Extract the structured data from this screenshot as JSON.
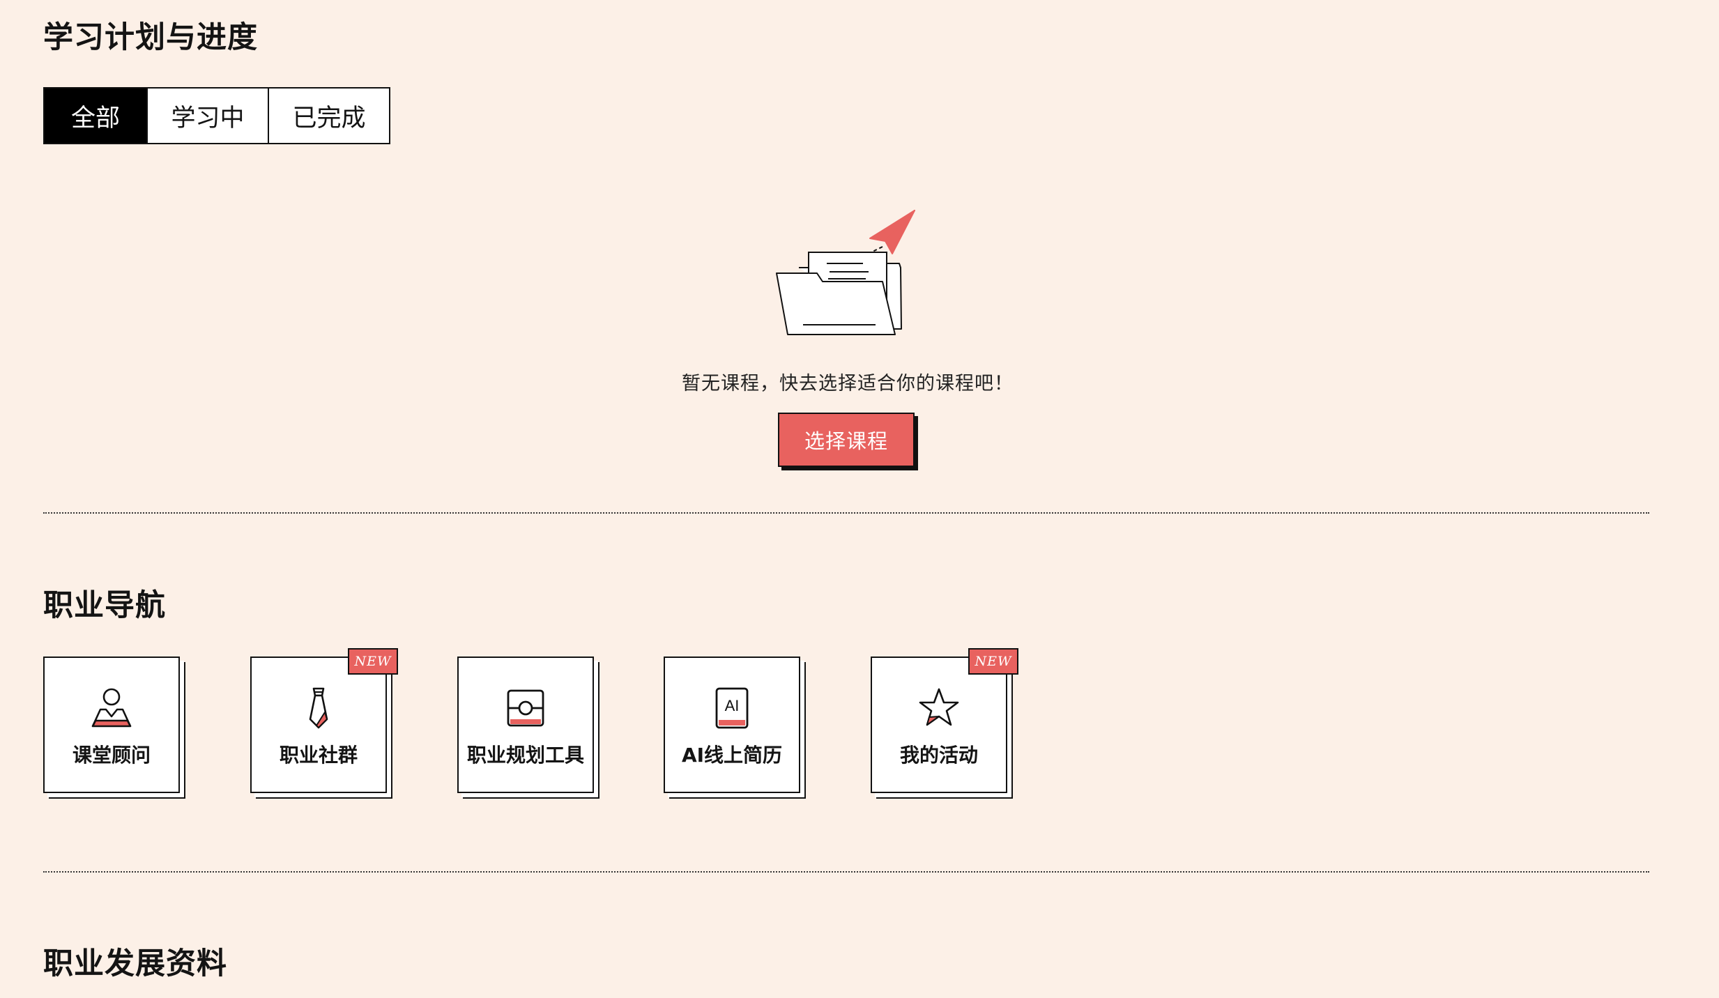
{
  "plan_section": {
    "title": "学习计划与进度",
    "tabs": [
      {
        "label": "全部",
        "active": true
      },
      {
        "label": "学习中",
        "active": false
      },
      {
        "label": "已完成",
        "active": false
      }
    ],
    "empty_state": {
      "illustration_icon": "folder-paper-plane-icon",
      "message": "暂无课程，快去选择适合你的课程吧！",
      "button_label": "选择课程"
    }
  },
  "nav_section": {
    "title": "职业导航",
    "cards": [
      {
        "label": "课堂顾问",
        "icon": "advisor-icon",
        "badge": ""
      },
      {
        "label": "职业社群",
        "icon": "tie-icon",
        "badge": "NEW"
      },
      {
        "label": "职业规划工具",
        "icon": "planner-icon",
        "badge": ""
      },
      {
        "label": "AI线上简历",
        "icon": "ai-resume-icon",
        "icon_text": "AI",
        "badge": ""
      },
      {
        "label": "我的活动",
        "icon": "star-icon",
        "badge": "NEW"
      }
    ]
  },
  "resources_section": {
    "title": "职业发展资料"
  },
  "colors": {
    "background": "#fcf0e7",
    "accent": "#e8625f",
    "ink": "#111111"
  }
}
